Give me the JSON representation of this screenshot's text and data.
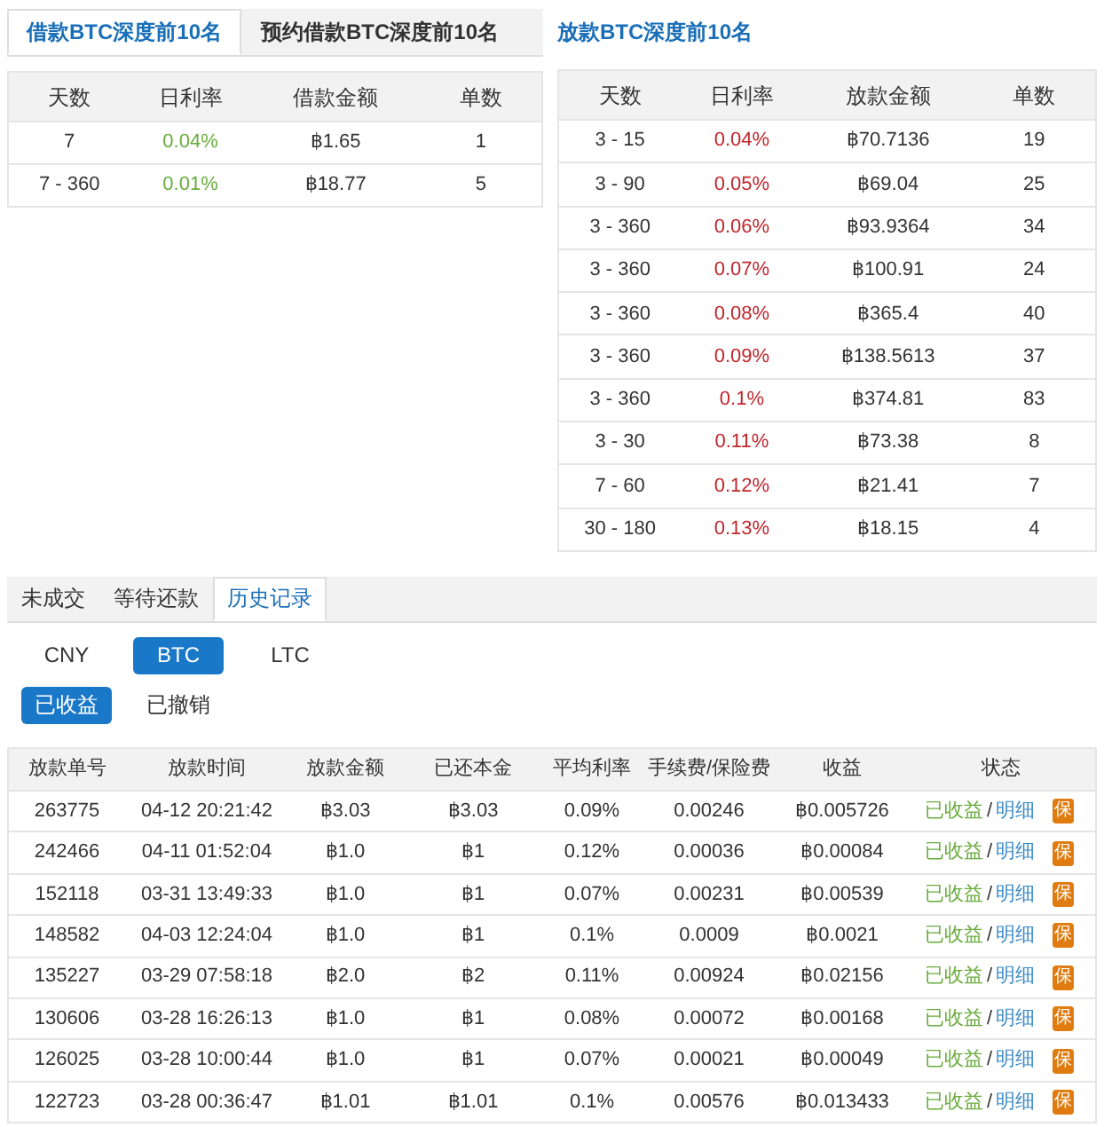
{
  "borrow_tabs": [
    {
      "label": "借款BTC深度前10名",
      "selected": true
    },
    {
      "label": "预约借款BTC深度前10名",
      "selected": false
    }
  ],
  "borrow_table": {
    "columns": [
      "天数",
      "日利率",
      "借款金额",
      "单数"
    ],
    "rows": [
      [
        "7",
        "0.04%",
        "฿1.65",
        "1"
      ],
      [
        "7 - 360",
        "0.01%",
        "฿18.77",
        "5"
      ]
    ]
  },
  "lend_title": "放款BTC深度前10名",
  "lend_table": {
    "columns": [
      "天数",
      "日利率",
      "放款金额",
      "单数"
    ],
    "rows": [
      [
        "3 - 15",
        "0.04%",
        "฿70.7136",
        "19"
      ],
      [
        "3 - 90",
        "0.05%",
        "฿69.04",
        "25"
      ],
      [
        "3 - 360",
        "0.06%",
        "฿93.9364",
        "34"
      ],
      [
        "3 - 360",
        "0.07%",
        "฿100.91",
        "24"
      ],
      [
        "3 - 360",
        "0.08%",
        "฿365.4",
        "40"
      ],
      [
        "3 - 360",
        "0.09%",
        "฿138.5613",
        "37"
      ],
      [
        "3 - 360",
        "0.1%",
        "฿374.81",
        "83"
      ],
      [
        "3 - 30",
        "0.11%",
        "฿73.38",
        "8"
      ],
      [
        "7 - 60",
        "0.12%",
        "฿21.41",
        "7"
      ],
      [
        "30 - 180",
        "0.13%",
        "฿18.15",
        "4"
      ]
    ]
  },
  "record_tabs": [
    {
      "label": "未成交",
      "selected": false
    },
    {
      "label": "等待还款",
      "selected": false
    },
    {
      "label": "历史记录",
      "selected": true
    }
  ],
  "currency_buttons": [
    {
      "label": "CNY",
      "selected": false
    },
    {
      "label": "BTC",
      "selected": true
    },
    {
      "label": "LTC",
      "selected": false
    }
  ],
  "status_buttons": [
    {
      "label": "已收益",
      "selected": true
    },
    {
      "label": "已撤销",
      "selected": false
    }
  ],
  "history_table": {
    "columns": [
      "放款单号",
      "放款时间",
      "放款金额",
      "已还本金",
      "平均利率",
      "手续费/保险费",
      "收益",
      "状态"
    ],
    "rows": [
      {
        "cells": [
          "263775",
          "04-12 20:21:42",
          "฿3.03",
          "฿3.03",
          "0.09%",
          "0.00246",
          "฿0.005726"
        ],
        "status": "已收益",
        "separator": "/",
        "detail": "明细",
        "badge": "保"
      },
      {
        "cells": [
          "242466",
          "04-11 01:52:04",
          "฿1.0",
          "฿1",
          "0.12%",
          "0.00036",
          "฿0.00084"
        ],
        "status": "已收益",
        "separator": "/",
        "detail": "明细",
        "badge": "保"
      },
      {
        "cells": [
          "152118",
          "03-31 13:49:33",
          "฿1.0",
          "฿1",
          "0.07%",
          "0.00231",
          "฿0.00539"
        ],
        "status": "已收益",
        "separator": "/",
        "detail": "明细",
        "badge": "保"
      },
      {
        "cells": [
          "148582",
          "04-03 12:24:04",
          "฿1.0",
          "฿1",
          "0.1%",
          "0.0009",
          "฿0.0021"
        ],
        "status": "已收益",
        "separator": "/",
        "detail": "明细",
        "badge": "保"
      },
      {
        "cells": [
          "135227",
          "03-29 07:58:18",
          "฿2.0",
          "฿2",
          "0.11%",
          "0.00924",
          "฿0.02156"
        ],
        "status": "已收益",
        "separator": "/",
        "detail": "明细",
        "badge": "保"
      },
      {
        "cells": [
          "130606",
          "03-28 16:26:13",
          "฿1.0",
          "฿1",
          "0.08%",
          "0.00072",
          "฿0.00168"
        ],
        "status": "已收益",
        "separator": "/",
        "detail": "明细",
        "badge": "保"
      },
      {
        "cells": [
          "126025",
          "03-28 10:00:44",
          "฿1.0",
          "฿1",
          "0.07%",
          "0.00021",
          "฿0.00049"
        ],
        "status": "已收益",
        "separator": "/",
        "detail": "明细",
        "badge": "保"
      },
      {
        "cells": [
          "122723",
          "03-28 00:36:47",
          "฿1.01",
          "฿1.01",
          "0.1%",
          "0.00576",
          "฿0.013433"
        ],
        "status": "已收益",
        "separator": "/",
        "detail": "明细",
        "badge": "保"
      }
    ]
  }
}
